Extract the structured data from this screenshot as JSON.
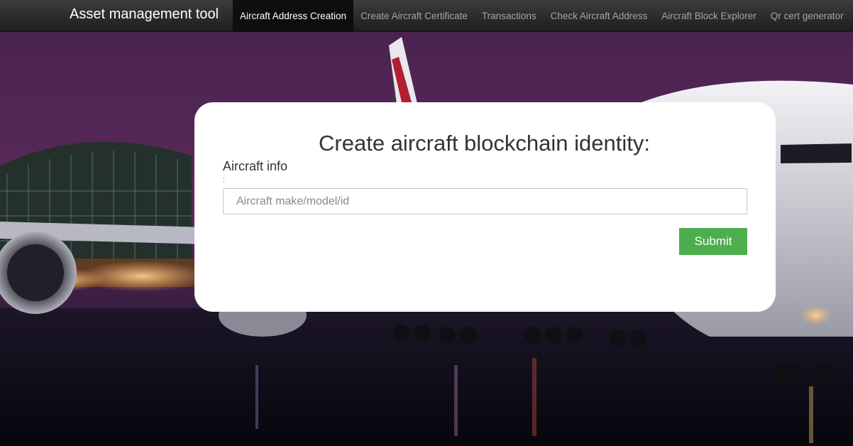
{
  "navbar": {
    "brand": "Asset management tool",
    "items": [
      {
        "label": "Aircraft Address Creation",
        "active": true
      },
      {
        "label": "Create Aircraft Certificate",
        "active": false
      },
      {
        "label": "Transactions",
        "active": false
      },
      {
        "label": "Check Aircraft Address",
        "active": false
      },
      {
        "label": "Aircraft Block Explorer",
        "active": false
      },
      {
        "label": "Qr cert generator",
        "active": false
      }
    ]
  },
  "form": {
    "title": "Create aircraft blockchain identity:",
    "field_label": "Aircraft info",
    "field_label_suffix": ":",
    "input_value": "",
    "input_placeholder": "Aircraft make/model/id",
    "submit_label": "Submit"
  },
  "colors": {
    "navbar_bg": "#2b2b2b",
    "active_tab_bg": "#0e0e0e",
    "submit_bg": "#4cae4c",
    "card_bg": "#ffffff"
  }
}
